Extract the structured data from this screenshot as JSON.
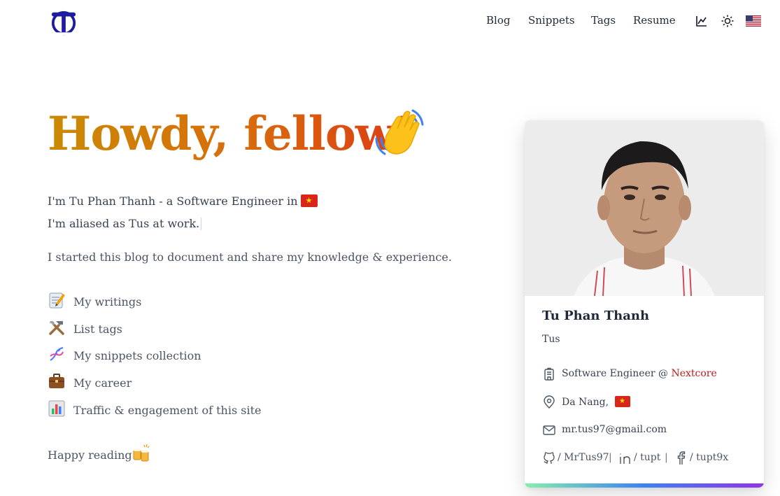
{
  "nav": {
    "links": [
      "Blog",
      "Snippets",
      "Tags",
      "Resume"
    ],
    "icons": [
      "analytics-icon",
      "sun-icon",
      "us-flag-icon"
    ]
  },
  "hero": {
    "title": "Howdy, fellow!",
    "intro1": "I'm Tu Phan Thanh - a Software Engineer in",
    "intro2": "I'm aliased as Tus at work.",
    "desc": "I started this blog to document and share my knowledge & experience."
  },
  "links": [
    {
      "icon": "memo-icon",
      "label": "My writings"
    },
    {
      "icon": "tools-icon",
      "label": "List tags"
    },
    {
      "icon": "dna-icon",
      "label": "My snippets collection"
    },
    {
      "icon": "briefcase-icon",
      "label": "My career"
    },
    {
      "icon": "bar-chart-icon",
      "label": "Traffic & engagement of this site"
    }
  ],
  "footer": {
    "happy": "Happy reading"
  },
  "card": {
    "name": "Tu Phan Thanh",
    "alias": "Tus",
    "job_prefix": "Software Engineer @",
    "company": "Nextcore",
    "location": "Da Nang,",
    "email": "mr.tus97@gmail.com",
    "social": [
      {
        "icon": "github-icon",
        "handle": "/ MrTus97"
      },
      {
        "icon": "linkedin-icon",
        "handle": "/ tupt"
      },
      {
        "icon": "facebook-icon",
        "handle": "/ tupt9x"
      }
    ],
    "separator": "|"
  },
  "colors": {
    "title_gradient": [
      "#ca8a04",
      "#d86b0c",
      "#dc3a16"
    ],
    "company": "#b91c1c",
    "logo": "#1e1b9e",
    "card_bar": [
      "#86efac",
      "#3b82f6",
      "#9333ea"
    ]
  }
}
